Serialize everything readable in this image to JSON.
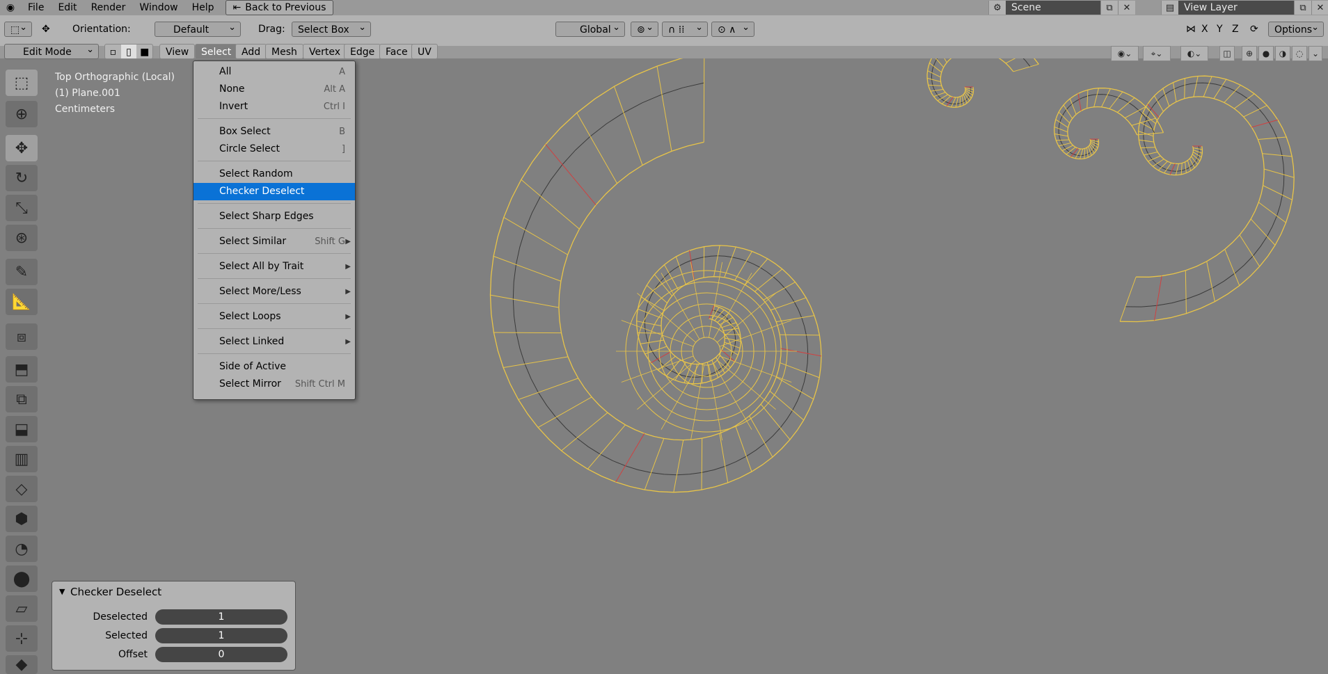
{
  "topbar": {
    "menus": [
      "File",
      "Edit",
      "Render",
      "Window",
      "Help"
    ],
    "back_label": "Back to Previous",
    "scene": "Scene",
    "view_layer": "View Layer"
  },
  "toolheader": {
    "orientation_label": "Orientation:",
    "orientation_value": "Default",
    "drag_label": "Drag:",
    "drag_value": "Select Box",
    "transform_value": "Global",
    "axis_x": "X",
    "axis_y": "Y",
    "axis_z": "Z",
    "options_label": "Options"
  },
  "header": {
    "mode": "Edit Mode",
    "menus": [
      "View",
      "Select",
      "Add",
      "Mesh",
      "Vertex",
      "Edge",
      "Face",
      "UV"
    ]
  },
  "viewport_info": {
    "view": "Top Orthographic (Local)",
    "object": "(1) Plane.001",
    "units": "Centimeters"
  },
  "select_menu": {
    "items": [
      {
        "label": "All",
        "shortcut": "A"
      },
      {
        "label": "None",
        "shortcut": "Alt A"
      },
      {
        "label": "Invert",
        "shortcut": "Ctrl I"
      },
      {
        "label": "Box Select",
        "shortcut": "B"
      },
      {
        "label": "Circle Select",
        "shortcut": "]"
      },
      {
        "label": "Select Random",
        "shortcut": ""
      },
      {
        "label": "Checker Deselect",
        "shortcut": ""
      },
      {
        "label": "Select Sharp Edges",
        "shortcut": ""
      },
      {
        "label": "Select Similar",
        "shortcut": "Shift G"
      },
      {
        "label": "Select All by Trait",
        "shortcut": ""
      },
      {
        "label": "Select More/Less",
        "shortcut": ""
      },
      {
        "label": "Select Loops",
        "shortcut": ""
      },
      {
        "label": "Select Linked",
        "shortcut": ""
      },
      {
        "label": "Side of Active",
        "shortcut": ""
      },
      {
        "label": "Select Mirror",
        "shortcut": "Shift Ctrl M"
      }
    ],
    "highlighted": "Checker Deselect"
  },
  "operator_panel": {
    "title": "Checker Deselect",
    "fields": [
      {
        "label": "Deselected",
        "value": "1"
      },
      {
        "label": "Selected",
        "value": "1"
      },
      {
        "label": "Offset",
        "value": "0"
      }
    ]
  },
  "colors": {
    "highlight": "#0a72d6",
    "wire": "#e8c448",
    "seam": "#d04040"
  }
}
